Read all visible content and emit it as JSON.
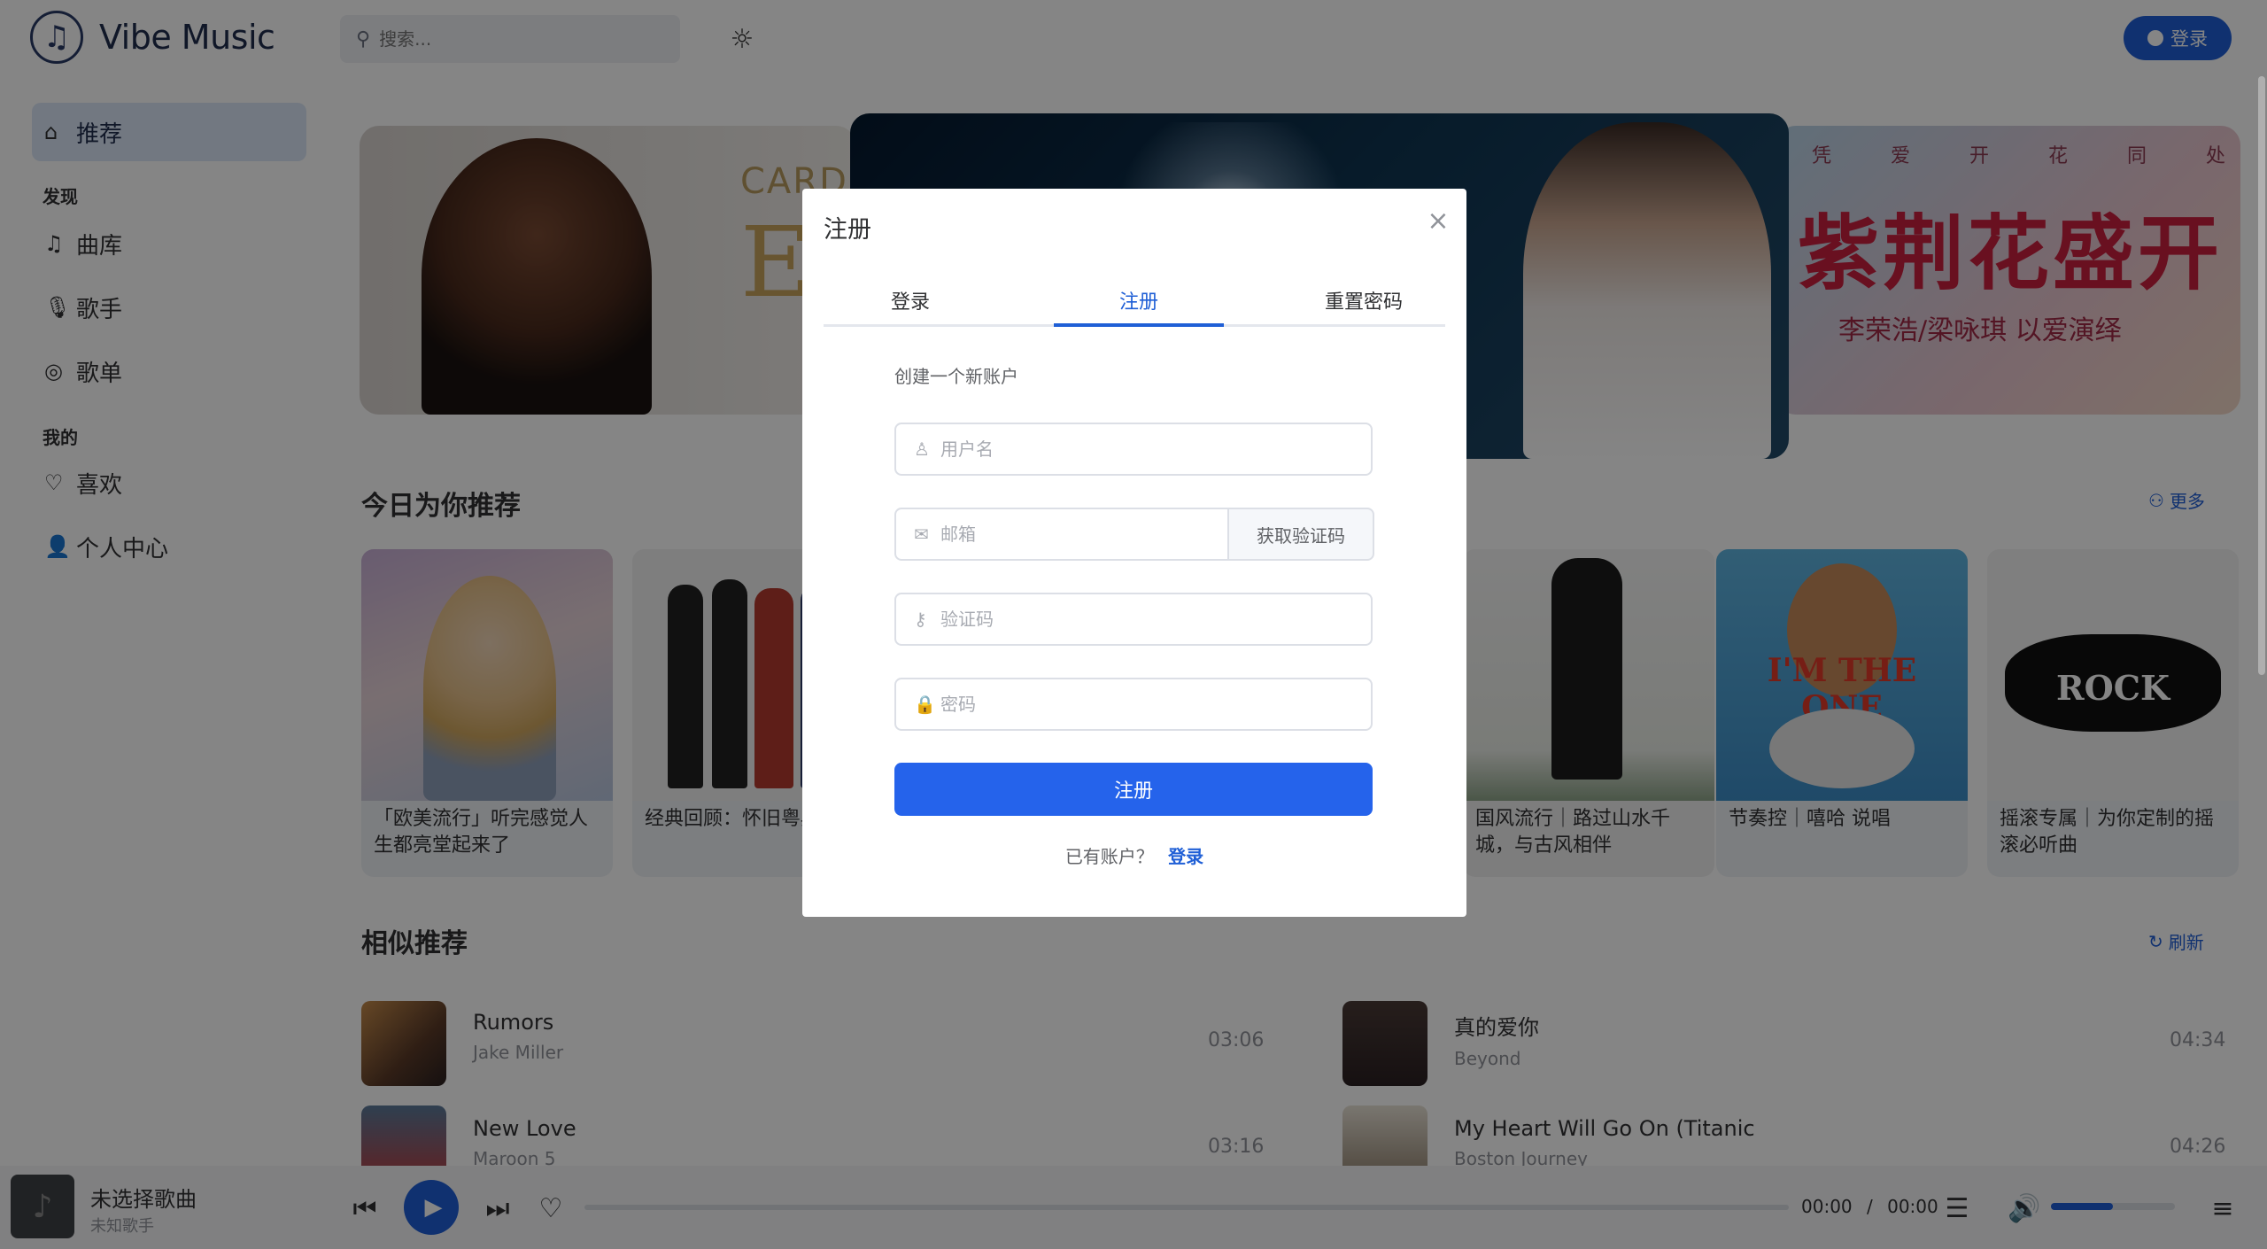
{
  "header": {
    "logo_text": "Vibe Music",
    "search_placeholder": "搜索...",
    "login_label": "登录"
  },
  "sidebar": {
    "recommend": "推荐",
    "group_discover": "发现",
    "library": "曲库",
    "artists": "歌手",
    "playlists": "歌单",
    "group_mine": "我的",
    "likes": "喜欢",
    "profile": "个人中心"
  },
  "banners": {
    "left_brand": "CARD",
    "left_big": "E",
    "right_tagline": "凭 爱 开 花 同 处 一 家",
    "right_title": "紫荆花盛开",
    "right_artists": "李荣浩/梁咏琪 以爱演绎"
  },
  "today": {
    "title": "今日为你推荐",
    "more": "更多",
    "cards": [
      {
        "title": "「欧美流行」听完感觉人生都亮堂起来了"
      },
      {
        "title": "经典回顾：怀旧粤典老歌"
      },
      {
        "title": "国风流行｜路过山水千城，与古风相伴"
      },
      {
        "title": "节奏控｜嘻哈 说唱"
      },
      {
        "title": "摇滚专属｜为你定制的摇滚必听曲"
      }
    ],
    "cover_texts": {
      "oneline": "I'M THE ONE",
      "rock": "ROCK"
    }
  },
  "similar": {
    "title": "相似推荐",
    "refresh": "刷新",
    "songs": [
      {
        "name": "Rumors",
        "artist": "Jake Miller",
        "duration": "03:06"
      },
      {
        "name": "真的爱你",
        "artist": "Beyond",
        "duration": "04:34"
      },
      {
        "name": "New Love",
        "artist": "Maroon 5",
        "duration": "03:16"
      },
      {
        "name": "My Heart Will Go On (Titanic",
        "artist": "Boston Journey",
        "duration": "04:26"
      }
    ]
  },
  "player": {
    "title": "未选择歌曲",
    "artist": "未知歌手",
    "current_time": "00:00",
    "separator": "/",
    "total_time": "00:00",
    "volume_fraction": 0.5
  },
  "modal": {
    "title": "注册",
    "tabs": [
      "登录",
      "注册",
      "重置密码"
    ],
    "active_tab": 1,
    "subtitle": "创建一个新账户",
    "username_placeholder": "用户名",
    "email_placeholder": "邮箱",
    "get_code_label": "获取验证码",
    "code_placeholder": "验证码",
    "password_placeholder": "密码",
    "submit_label": "注册",
    "footer_prompt": "已有账户？",
    "footer_link": "登录"
  },
  "colors": {
    "accent": "#1f5fd6",
    "primary_button": "#2563eb",
    "active_nav_bg": "#dbe7f7"
  }
}
